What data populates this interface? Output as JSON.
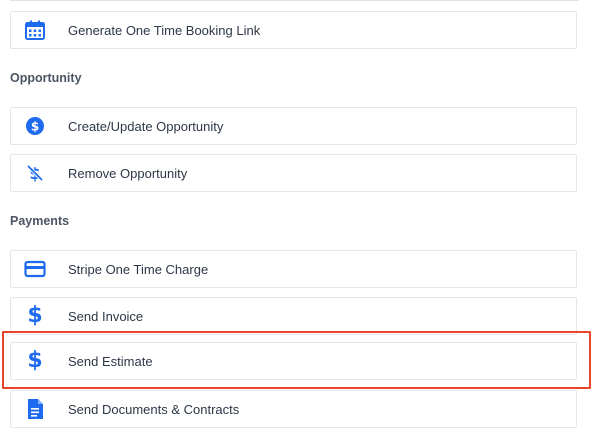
{
  "items_top": [
    {
      "label": "Generate One Time Booking Link",
      "icon": "calendar-icon"
    }
  ],
  "sections": [
    {
      "title": "Opportunity",
      "items": [
        {
          "label": "Create/Update Opportunity",
          "icon": "dollar-circle-icon"
        },
        {
          "label": "Remove Opportunity",
          "icon": "dollar-slash-icon"
        }
      ]
    },
    {
      "title": "Payments",
      "items": [
        {
          "label": "Stripe One Time Charge",
          "icon": "credit-card-icon"
        },
        {
          "label": "Send Invoice",
          "icon": "dollar-icon"
        },
        {
          "label": "Send Estimate",
          "icon": "dollar-icon"
        },
        {
          "label": "Send Documents & Contracts",
          "icon": "document-icon"
        }
      ]
    }
  ],
  "colors": {
    "accent": "#1e6bf0",
    "highlight": "#e8452a",
    "border": "#e3e7ed"
  }
}
